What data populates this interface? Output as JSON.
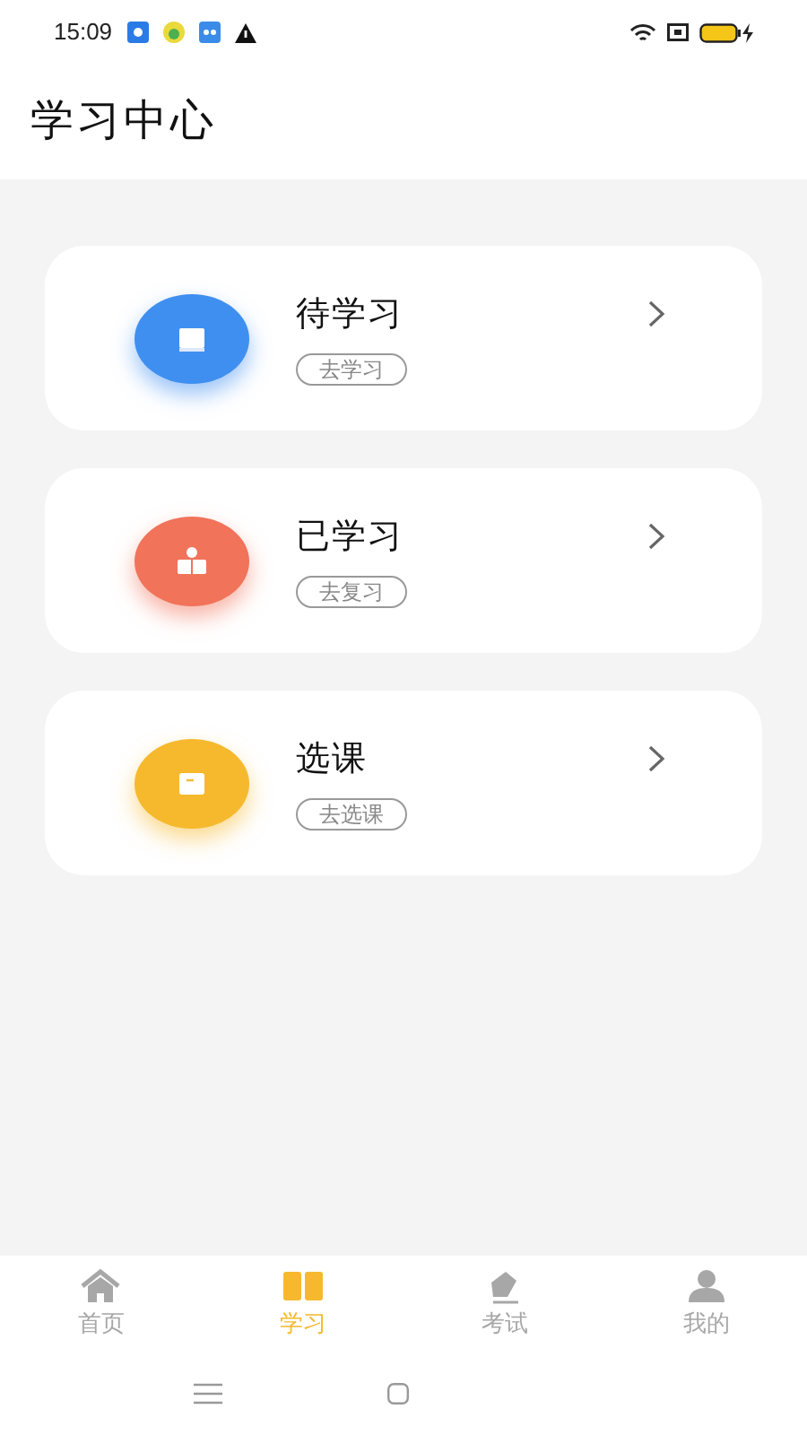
{
  "status_bar": {
    "time": "15:09"
  },
  "header": {
    "title": "学习中心"
  },
  "cards": [
    {
      "kind": "book",
      "title": "待学习",
      "action": "去学习",
      "color": "#3f8ff0"
    },
    {
      "kind": "reader",
      "title": "已学习",
      "action": "去复习",
      "color": "#f0735a"
    },
    {
      "kind": "note",
      "title": "选课",
      "action": "去选课",
      "color": "#f6b92e"
    }
  ],
  "tabs": [
    {
      "kind": "home",
      "label": "首页",
      "selected": false
    },
    {
      "kind": "study",
      "label": "学习",
      "selected": true
    },
    {
      "kind": "exam",
      "label": "考试",
      "selected": false
    },
    {
      "kind": "me",
      "label": "我的",
      "selected": false
    }
  ]
}
